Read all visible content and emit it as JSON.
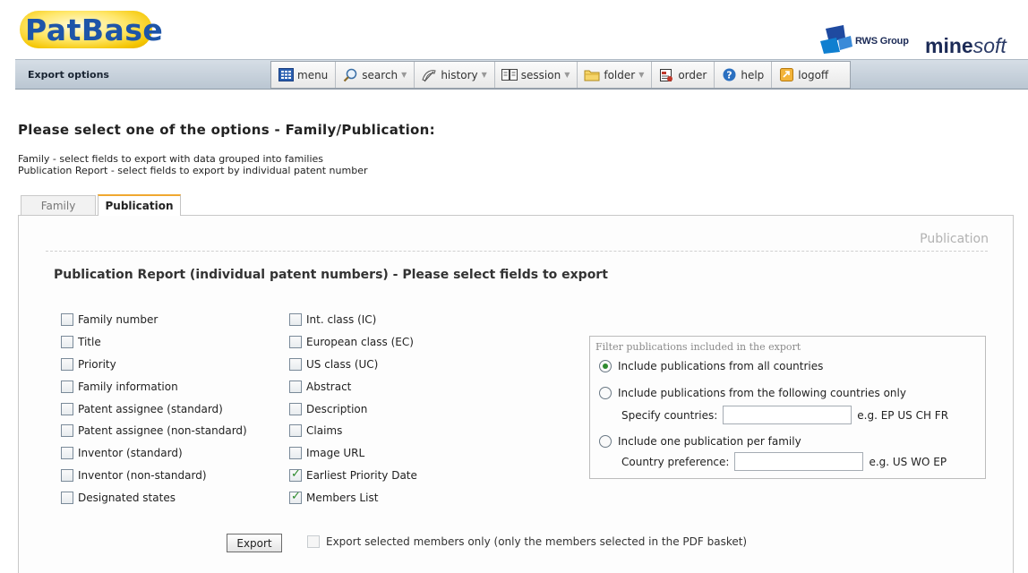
{
  "header": {
    "logo_text": "PatBase",
    "partner_label": "RWS Group",
    "brand_bold": "mine",
    "brand_italic": "soft"
  },
  "toolbar": {
    "title": "Export options",
    "buttons": [
      {
        "label": "menu",
        "icon": "menu-grid-icon"
      },
      {
        "label": "search",
        "icon": "magnifier-icon",
        "dropdown": true
      },
      {
        "label": "history",
        "icon": "history-icon",
        "dropdown": true
      },
      {
        "label": "session",
        "icon": "book-icon",
        "dropdown": true
      },
      {
        "label": "folder",
        "icon": "folder-icon",
        "dropdown": true
      },
      {
        "label": "order",
        "icon": "order-icon"
      },
      {
        "label": "help",
        "icon": "help-icon"
      },
      {
        "label": "logoff",
        "icon": "logoff-icon"
      }
    ]
  },
  "page": {
    "heading": "Please select one of the options - Family/Publication:",
    "desc_family": "Family - select fields to export with data grouped into families",
    "desc_publication": "Publication Report - select fields to export by individual patent number"
  },
  "tabs": {
    "family": "Family",
    "publication": "Publication"
  },
  "panel": {
    "label": "Publication",
    "section_title": "Publication Report (individual patent numbers) - Please select fields to export"
  },
  "fields_col1": [
    {
      "label": "Family number",
      "checked": false
    },
    {
      "label": "Title",
      "checked": false
    },
    {
      "label": "Priority",
      "checked": false
    },
    {
      "label": "Family information",
      "checked": false
    },
    {
      "label": "Patent assignee (standard)",
      "checked": false
    },
    {
      "label": "Patent assignee (non-standard)",
      "checked": false
    },
    {
      "label": "Inventor (standard)",
      "checked": false
    },
    {
      "label": "Inventor (non-standard)",
      "checked": false
    },
    {
      "label": "Designated states",
      "checked": false
    }
  ],
  "fields_col2": [
    {
      "label": "Int. class (IC)",
      "checked": false
    },
    {
      "label": "European class (EC)",
      "checked": false
    },
    {
      "label": "US class (UC)",
      "checked": false
    },
    {
      "label": "Abstract",
      "checked": false
    },
    {
      "label": "Description",
      "checked": false
    },
    {
      "label": "Claims",
      "checked": false
    },
    {
      "label": "Image URL",
      "checked": false
    },
    {
      "label": "Earliest Priority Date",
      "checked": true
    },
    {
      "label": "Members List",
      "checked": true
    }
  ],
  "filter": {
    "legend": "Filter publications included in the export",
    "opt_all": "Include publications from all countries",
    "opt_following": "Include publications from the following countries only",
    "specify_label": "Specify countries:",
    "specify_value": "",
    "specify_example": "e.g.  EP US CH FR",
    "opt_one": "Include one publication per family",
    "pref_label": "Country preference:",
    "pref_value": "",
    "pref_example": "e.g.  US WO EP",
    "selected": "all"
  },
  "actions": {
    "export_label": "Export",
    "export_members_label": "Export selected members only (only the members selected in the PDF basket)",
    "export_members_checked": false
  }
}
